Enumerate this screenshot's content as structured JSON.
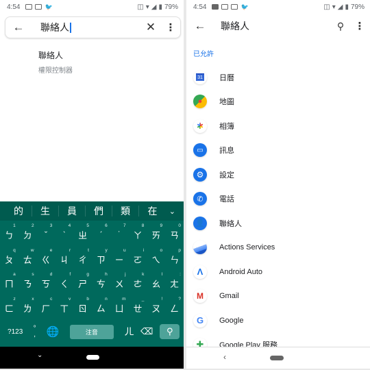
{
  "status_bar": {
    "time": "4:54",
    "battery": "79%"
  },
  "left": {
    "search": {
      "query": "聯絡人"
    },
    "result": {
      "title": "聯絡人",
      "subtitle": "權限控制器"
    },
    "keyboard": {
      "suggestions": [
        "的",
        "生",
        "員",
        "們",
        "類",
        "在"
      ],
      "rows": [
        [
          [
            "1",
            "ㄅ"
          ],
          [
            "2",
            "ㄉ"
          ],
          [
            "3",
            "ˇ"
          ],
          [
            "4",
            "ˋ"
          ],
          [
            "5",
            "ㄓ"
          ],
          [
            "6",
            "ˊ"
          ],
          [
            "7",
            "˙"
          ],
          [
            "8",
            "ㄚ"
          ],
          [
            "9",
            "ㄞ"
          ],
          [
            "0",
            "ㄢ"
          ]
        ],
        [
          [
            "q",
            "ㄆ"
          ],
          [
            "w",
            "ㄊ"
          ],
          [
            "e",
            "ㄍ"
          ],
          [
            "r",
            "ㄐ"
          ],
          [
            "t",
            "ㄔ"
          ],
          [
            "y",
            "ㄗ"
          ],
          [
            "u",
            "ㄧ"
          ],
          [
            "i",
            "ㄛ"
          ],
          [
            "o",
            "ㄟ"
          ],
          [
            "p",
            "ㄣ"
          ]
        ],
        [
          [
            "a",
            "ㄇ"
          ],
          [
            "s",
            "ㄋ"
          ],
          [
            "d",
            "ㄎ"
          ],
          [
            "f",
            "ㄑ"
          ],
          [
            "g",
            "ㄕ"
          ],
          [
            "h",
            "ㄘ"
          ],
          [
            "j",
            "ㄨ"
          ],
          [
            "k",
            "ㄜ"
          ],
          [
            "l",
            "ㄠ"
          ],
          [
            ":",
            "ㄤ"
          ]
        ],
        [
          [
            "z",
            "ㄈ"
          ],
          [
            "x",
            "ㄌ"
          ],
          [
            "c",
            "ㄏ"
          ],
          [
            "v",
            "ㄒ"
          ],
          [
            "b",
            "ㄖ"
          ],
          [
            "n",
            "ㄙ"
          ],
          [
            "m",
            "ㄩ"
          ],
          [
            "_",
            "ㄝ"
          ],
          [
            "!",
            "ㄡ"
          ],
          [
            "?",
            "ㄥ"
          ]
        ]
      ],
      "symbols_label": "?123",
      "punct_top": "°",
      "punct_bottom": ",",
      "space_label": "注音",
      "er_key": "ㄦ"
    }
  },
  "right": {
    "title": "聯絡人",
    "section": "已允許",
    "apps": [
      {
        "name": "日曆",
        "icon": "calendar-icon"
      },
      {
        "name": "地圖",
        "icon": "maps-icon"
      },
      {
        "name": "相簿",
        "icon": "photos-icon"
      },
      {
        "name": "訊息",
        "icon": "messages-icon"
      },
      {
        "name": "設定",
        "icon": "settings-icon"
      },
      {
        "name": "電話",
        "icon": "phone-icon"
      },
      {
        "name": "聯絡人",
        "icon": "contacts-icon"
      },
      {
        "name": "Actions Services",
        "icon": "actions-services-icon"
      },
      {
        "name": "Android Auto",
        "icon": "android-auto-icon"
      },
      {
        "name": "Gmail",
        "icon": "gmail-icon"
      },
      {
        "name": "Google",
        "icon": "google-icon"
      },
      {
        "name": "Google Play 服務",
        "icon": "play-services-icon"
      }
    ]
  }
}
